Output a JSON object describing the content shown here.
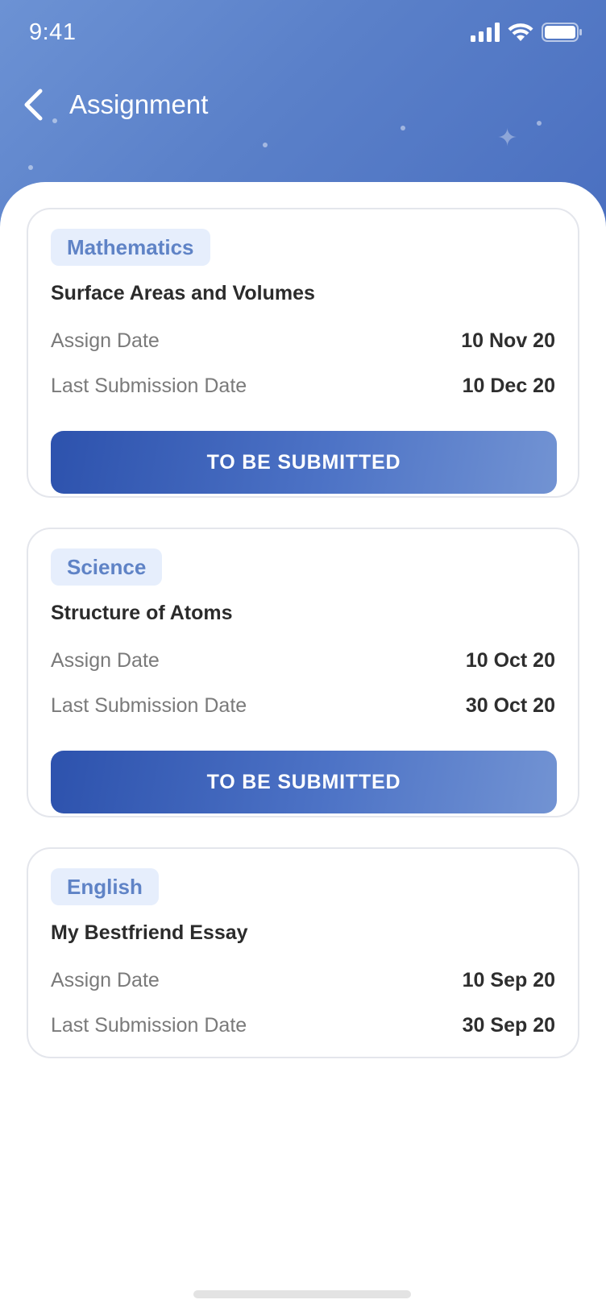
{
  "status_bar": {
    "time": "9:41"
  },
  "nav": {
    "title": "Assignment"
  },
  "assignments": [
    {
      "subject": "Mathematics",
      "title": "Surface Areas and Volumes",
      "assign_label": "Assign Date",
      "assign_date": "10 Nov 20",
      "last_label": "Last Submission Date",
      "last_date": "10 Dec 20",
      "button_label": "TO BE SUBMITTED"
    },
    {
      "subject": "Science",
      "title": "Structure of Atoms",
      "assign_label": "Assign Date",
      "assign_date": "10 Oct 20",
      "last_label": "Last Submission Date",
      "last_date": "30 Oct 20",
      "button_label": "TO BE SUBMITTED"
    },
    {
      "subject": "English",
      "title": "My Bestfriend Essay",
      "assign_label": "Assign Date",
      "assign_date": "10 Sep 20",
      "last_label": "Last Submission Date",
      "last_date": "30 Sep 20"
    }
  ],
  "colors": {
    "header_gradient_start": "#6c92d4",
    "header_gradient_end": "#4a6fc0",
    "badge_bg": "#e6eefc",
    "badge_text": "#5f83c6",
    "button_start": "#2d52ad",
    "button_end": "#7293d3"
  },
  "icons": {
    "back": "chevron-left-icon",
    "signal": "cellular-signal-icon",
    "wifi": "wifi-icon",
    "battery": "battery-icon"
  }
}
